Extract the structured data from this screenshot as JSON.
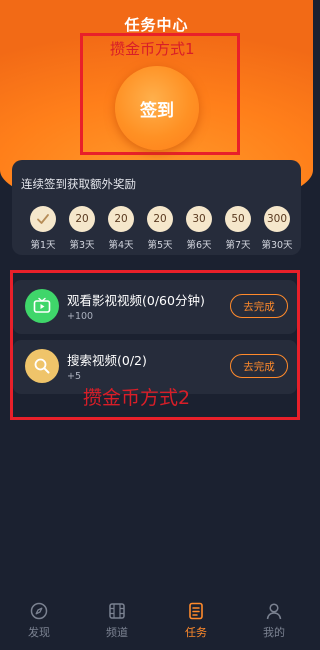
{
  "header": {
    "title": "任务中心"
  },
  "annotations": {
    "box1_label": "攒金币方式1",
    "box2_label": "攒金币方式2"
  },
  "checkin": {
    "label": "签到"
  },
  "streak": {
    "title": "连续签到获取额外奖励",
    "days": [
      {
        "reward": "",
        "label": "第1天",
        "checked": true
      },
      {
        "reward": "20",
        "label": "第3天"
      },
      {
        "reward": "20",
        "label": "第4天"
      },
      {
        "reward": "20",
        "label": "第5天"
      },
      {
        "reward": "30",
        "label": "第6天"
      },
      {
        "reward": "50",
        "label": "第7天"
      },
      {
        "reward": "300",
        "label": "第30天"
      }
    ]
  },
  "tasks": [
    {
      "title": "观看影视视频(0/60分钟)",
      "reward": "+100",
      "button": "去完成",
      "icon": "tv-icon",
      "icon_color": "#3fd66a"
    },
    {
      "title": "搜索视频(0/2)",
      "reward": "+5",
      "button": "去完成",
      "icon": "search-icon",
      "icon_color": "#efc46a"
    }
  ],
  "tabbar": {
    "items": [
      {
        "label": "发现",
        "icon": "compass-icon"
      },
      {
        "label": "频道",
        "icon": "film-icon"
      },
      {
        "label": "任务",
        "icon": "task-list-icon",
        "active": true
      },
      {
        "label": "我的",
        "icon": "user-icon"
      }
    ]
  },
  "colors": {
    "accent": "#ff8a2b",
    "background": "#1b2130",
    "card": "#262c3b",
    "annotation": "#e8202a"
  }
}
